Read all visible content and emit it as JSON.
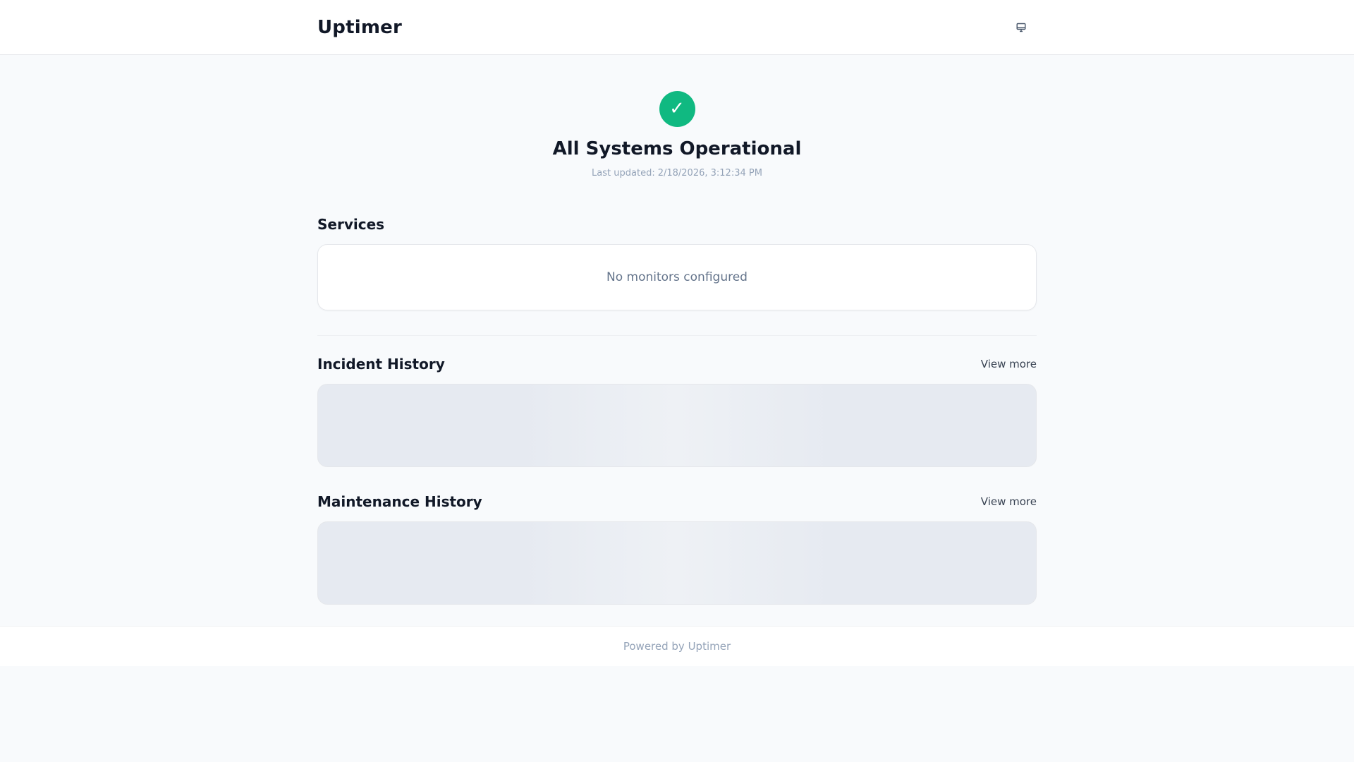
{
  "header": {
    "brand": "Uptimer",
    "theme_toggle_icon": "monitor-icon"
  },
  "hero": {
    "status_icon": "check-icon",
    "status_glyph": "✓",
    "status_color": "#10b981",
    "title": "All Systems Operational",
    "updated_label": "Last updated:",
    "updated_value": "2/18/2026, 3:12:34 PM"
  },
  "services": {
    "title": "Services",
    "empty_text": "No monitors configured"
  },
  "incidents": {
    "title": "Incident History",
    "view_more": "View more"
  },
  "maintenance": {
    "title": "Maintenance History",
    "view_more": "View more"
  },
  "footer": {
    "text": "Powered by Uptimer"
  }
}
